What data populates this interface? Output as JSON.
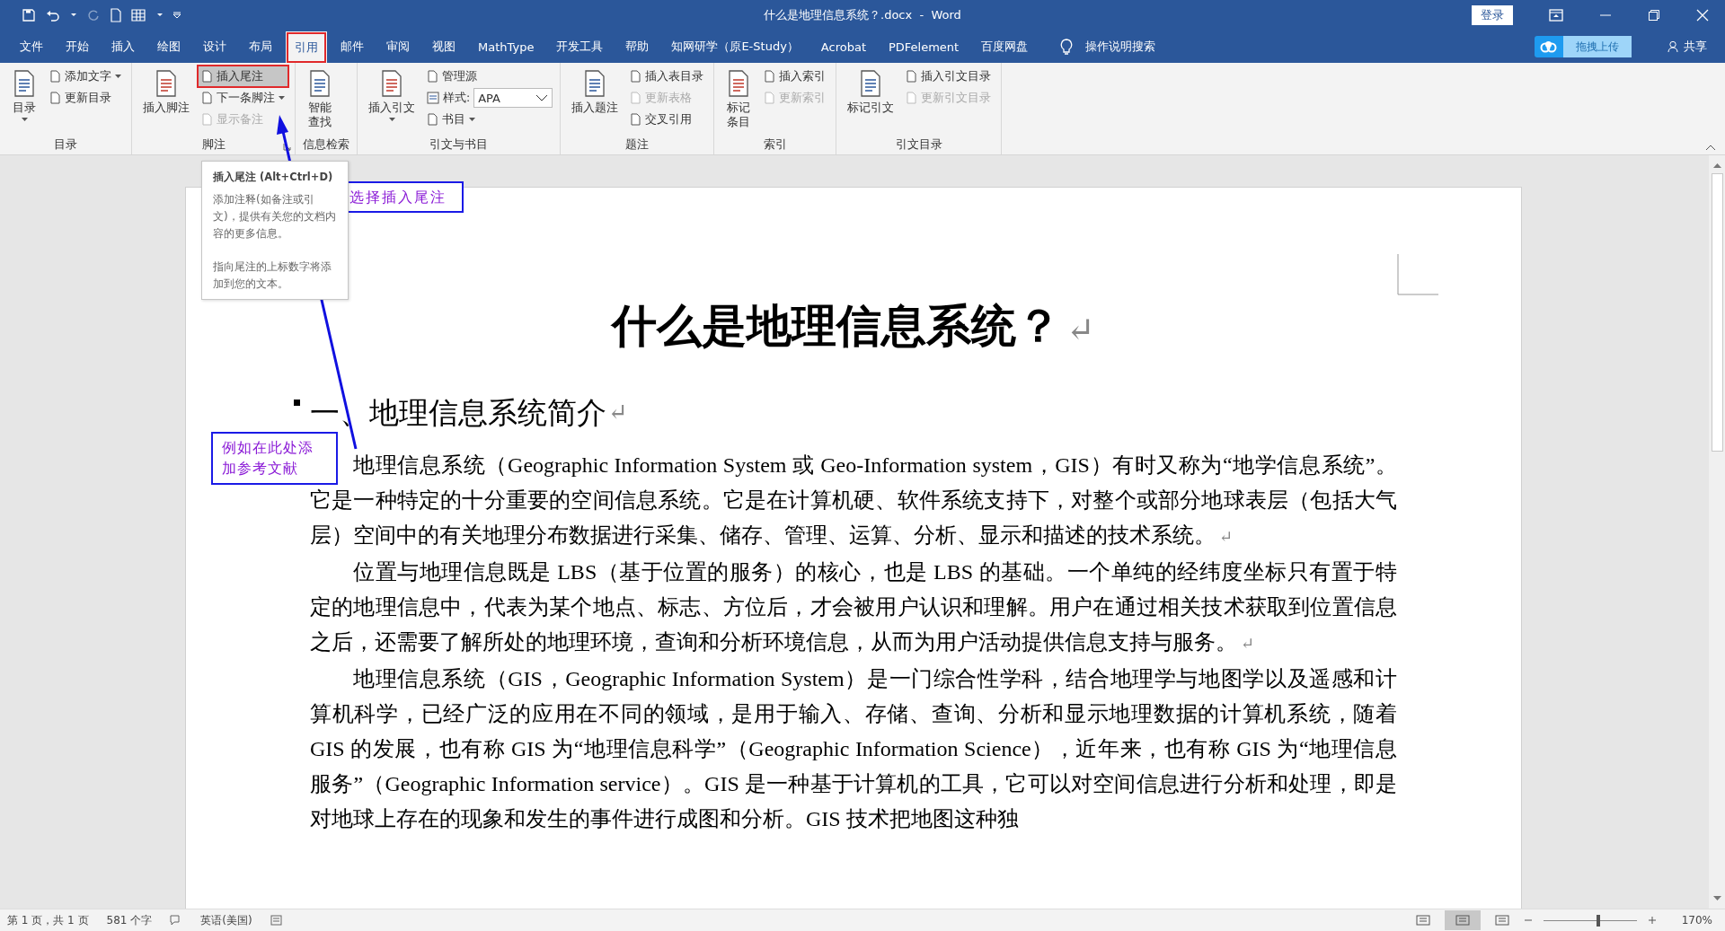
{
  "window": {
    "title": "什么是地理信息系统？.docx  -  Word",
    "login": "登录"
  },
  "tabs": [
    {
      "label": "文件",
      "selected": false
    },
    {
      "label": "开始",
      "selected": false
    },
    {
      "label": "插入",
      "selected": false
    },
    {
      "label": "绘图",
      "selected": false
    },
    {
      "label": "设计",
      "selected": false
    },
    {
      "label": "布局",
      "selected": false
    },
    {
      "label": "引用",
      "selected": true
    },
    {
      "label": "邮件",
      "selected": false
    },
    {
      "label": "审阅",
      "selected": false
    },
    {
      "label": "视图",
      "selected": false
    },
    {
      "label": "MathType",
      "selected": false
    },
    {
      "label": "开发工具",
      "selected": false
    },
    {
      "label": "帮助",
      "selected": false
    },
    {
      "label": "知网研学（原E-Study）",
      "selected": false
    },
    {
      "label": "Acrobat",
      "selected": false
    },
    {
      "label": "PDFelement",
      "selected": false
    },
    {
      "label": "百度网盘",
      "selected": false
    }
  ],
  "tell_me": "操作说明搜索",
  "upload_button": "拖拽上传",
  "share": "共享",
  "ribbon": {
    "groups": [
      {
        "label": "目录",
        "launcher": false,
        "large": [
          {
            "label": "目录",
            "dropdown": true
          }
        ],
        "small": [
          {
            "label": "添加文字",
            "kind": "button",
            "dropdown": true,
            "disabled": false,
            "highlighted": false
          },
          {
            "label": "更新目录",
            "kind": "button",
            "dropdown": false,
            "disabled": false,
            "highlighted": false
          }
        ]
      },
      {
        "label": "脚注",
        "launcher": true,
        "large": [
          {
            "label": "插入脚注",
            "dropdown": false,
            "wrap": false
          }
        ],
        "small": [
          {
            "label": "插入尾注",
            "kind": "button",
            "dropdown": false,
            "disabled": false,
            "highlighted": true
          },
          {
            "label": "下一条脚注",
            "kind": "button",
            "dropdown": true,
            "disabled": false,
            "highlighted": false
          },
          {
            "label": "显示备注",
            "kind": "button",
            "dropdown": false,
            "disabled": true,
            "highlighted": false
          }
        ]
      },
      {
        "label": "信息检索",
        "launcher": false,
        "large": [
          {
            "label": "智能查找",
            "dropdown": false,
            "wrap": true
          }
        ]
      },
      {
        "label": "引文与书目",
        "launcher": false,
        "large": [
          {
            "label": "插入引文",
            "dropdown": true,
            "wrap": false
          }
        ],
        "small": [
          {
            "label": "管理源",
            "kind": "button",
            "dropdown": false,
            "disabled": false,
            "highlighted": false
          },
          {
            "label": "样式:",
            "kind": "select",
            "value": "APA"
          },
          {
            "label": "书目",
            "kind": "button",
            "dropdown": true,
            "disabled": false,
            "highlighted": false
          }
        ]
      },
      {
        "label": "题注",
        "launcher": false,
        "large": [
          {
            "label": "插入题注",
            "dropdown": false,
            "wrap": false
          }
        ],
        "small": [
          {
            "label": "插入表目录",
            "kind": "button",
            "dropdown": false,
            "disabled": false,
            "highlighted": false
          },
          {
            "label": "更新表格",
            "kind": "button",
            "dropdown": false,
            "disabled": true,
            "highlighted": false
          },
          {
            "label": "交叉引用",
            "kind": "button",
            "dropdown": false,
            "disabled": false,
            "highlighted": false
          }
        ]
      },
      {
        "label": "索引",
        "launcher": false,
        "large": [
          {
            "label": "标记条目",
            "dropdown": false,
            "wrap": true
          }
        ],
        "small": [
          {
            "label": "插入索引",
            "kind": "button",
            "dropdown": false,
            "disabled": false,
            "highlighted": false
          },
          {
            "label": "更新索引",
            "kind": "button",
            "dropdown": false,
            "disabled": true,
            "highlighted": false
          }
        ]
      },
      {
        "label": "引文目录",
        "launcher": false,
        "large": [
          {
            "label": "标记引文",
            "dropdown": false,
            "wrap": false
          }
        ],
        "small": [
          {
            "label": "插入引文目录",
            "kind": "button",
            "dropdown": false,
            "disabled": false,
            "highlighted": false
          },
          {
            "label": "更新引文目录",
            "kind": "button",
            "dropdown": false,
            "disabled": true,
            "highlighted": false
          }
        ]
      }
    ]
  },
  "tooltip": {
    "title": "插入尾注 (Alt+Ctrl+D)",
    "paragraphs": [
      "添加注释(如备注或引文)，提供有关您的文档内容的更多信息。",
      "指向尾注的上标数字将添加到您的文本。"
    ]
  },
  "annotations": [
    "选择插入尾注",
    "例如在此处添加参考文献"
  ],
  "document": {
    "title": "什么是地理信息系统？",
    "title_mark": "↵",
    "heading": "一、地理信息系统简介",
    "heading_mark": "↵",
    "paragraphs": [
      {
        "text": "地理信息系统（Geographic Information System 或 Geo-Information system，GIS）有时又称为“地学信息系统”。它是一种特定的十分重要的空间信息系统。它是在计算机硬、软件系统支持下，对整个或部分地球表层（包括大气层）空间中的有关地理分布数据进行采集、储存、管理、运算、分析、显示和描述的技术系统。",
        "mark": "↵"
      },
      {
        "text": "位置与地理信息既是 LBS（基于位置的服务）的核心，也是 LBS 的基础。一个单纯的经纬度坐标只有置于特定的地理信息中，代表为某个地点、标志、方位后，才会被用户认识和理解。用户在通过相关技术获取到位置信息之后，还需要了解所处的地理环境，查询和分析环境信息，从而为用户活动提供信息支持与服务。",
        "mark": "↵"
      },
      {
        "text": "地理信息系统（GIS，Geographic Information System）是一门综合性学科，结合地理学与地图学以及遥感和计算机科学，已经广泛的应用在不同的领域，是用于输入、存储、查询、分析和显示地理数据的计算机系统，随着 GIS 的发展，也有称 GIS 为“地理信息科学”（Geographic Information Science），近年来，也有称 GIS 为“地理信息服务”（Geographic Information service）。GIS 是一种基于计算机的工具，它可以对空间信息进行分析和处理，即是对地球上存在的现象和发生的事件进行成图和分析。GIS 技术把地图这种独"
      }
    ]
  },
  "status_bar": {
    "page": "第 1 页，共 1 页",
    "words": "581 个字",
    "language": "英语(美国)",
    "zoom": "170%",
    "zoom_level": {
      "level": 0.59
    },
    "views": [
      {
        "selected": false
      },
      {
        "selected": true
      },
      {
        "selected": false
      }
    ]
  }
}
